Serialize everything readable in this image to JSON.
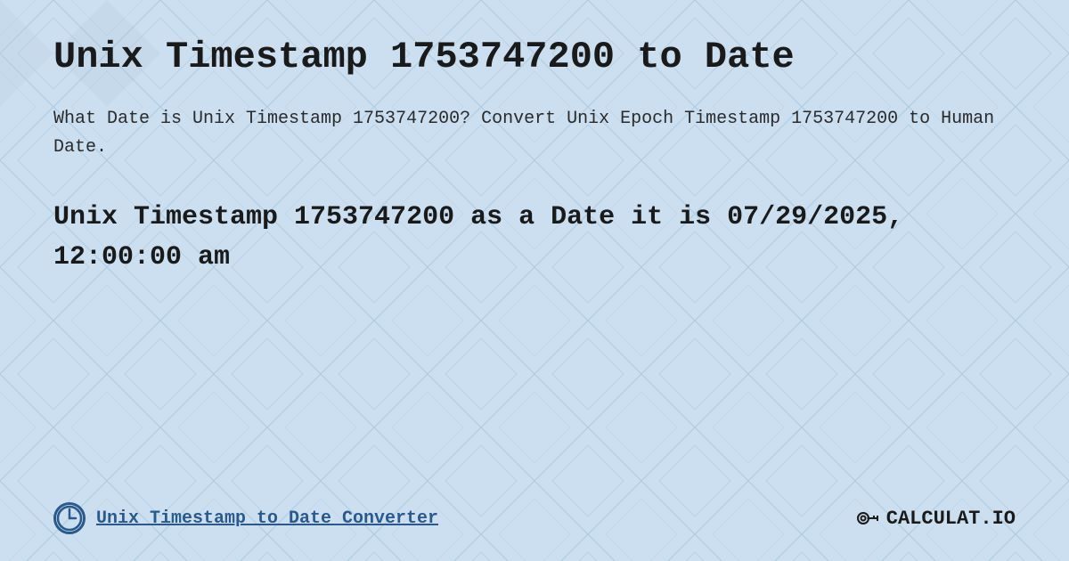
{
  "page": {
    "title": "Unix Timestamp 1753747200 to Date",
    "description": "What Date is Unix Timestamp 1753747200? Convert Unix Epoch Timestamp 1753747200 to Human Date.",
    "result": "Unix Timestamp 1753747200 as a Date it is 07/29/2025, 12:00:00 am",
    "footer_link": "Unix Timestamp to Date Converter",
    "logo_text": "CALCULAT.IO",
    "background_color": "#c8dff0",
    "pattern_color_light": "#b8d4e8",
    "pattern_color_dark": "#a8c4d8",
    "accent_color": "#2a5a8c"
  }
}
